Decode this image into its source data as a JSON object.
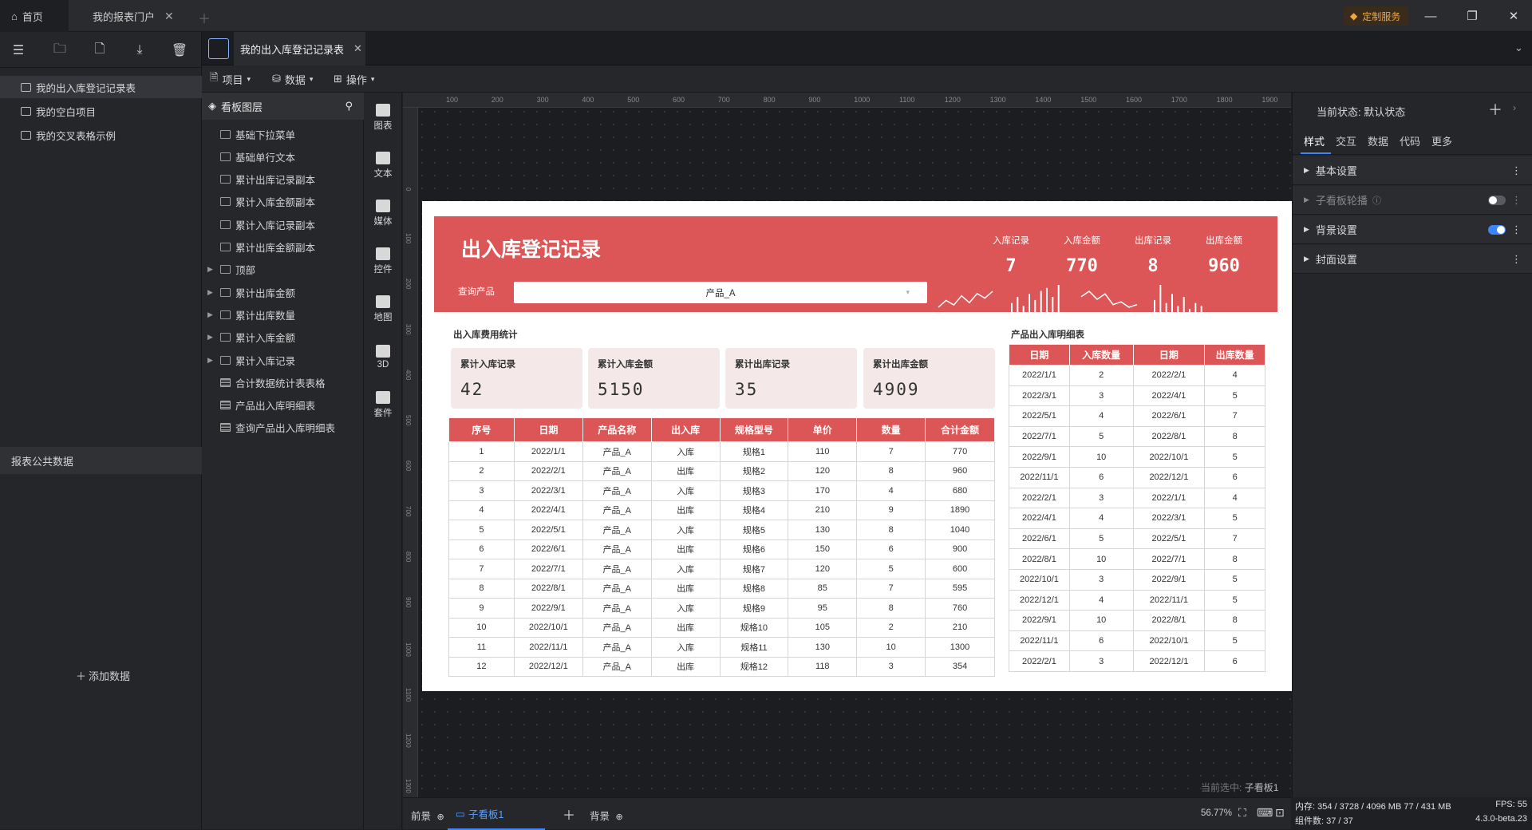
{
  "titlebar": {
    "tabs": [
      {
        "label": "首页",
        "icon": "home-icon"
      },
      {
        "label": "我的报表门户"
      }
    ],
    "custom_service": "定制服务"
  },
  "left_panel": {
    "projects": [
      {
        "label": "我的出入库登记记录表"
      },
      {
        "label": "我的空白项目"
      },
      {
        "label": "我的交叉表格示例"
      }
    ],
    "public_data_title": "报表公共数据",
    "add_data_label": "添加数据"
  },
  "doc_tab": {
    "label": "我的出入库登记记录表"
  },
  "toolbar": {
    "project": "项目",
    "data": "数据",
    "operate": "操作"
  },
  "layers": {
    "title": "看板图层",
    "items": [
      {
        "label": "基础下拉菜单",
        "group": false
      },
      {
        "label": "基础单行文本",
        "group": false
      },
      {
        "label": "累计出库记录副本",
        "group": false
      },
      {
        "label": "累计入库金额副本",
        "group": false
      },
      {
        "label": "累计入库记录副本",
        "group": false
      },
      {
        "label": "累计出库金额副本",
        "group": false
      },
      {
        "label": "顶部",
        "group": true
      },
      {
        "label": "累计出库金额",
        "group": true
      },
      {
        "label": "累计出库数量",
        "group": true
      },
      {
        "label": "累计入库金额",
        "group": true
      },
      {
        "label": "累计入库记录",
        "group": true
      },
      {
        "label": "合计数据统计表表格",
        "group": false
      },
      {
        "label": "产品出入库明细表",
        "group": false
      },
      {
        "label": "查询产品出入库明细表",
        "group": false
      }
    ]
  },
  "strip": [
    {
      "label": "图表",
      "icon": "chart-icon"
    },
    {
      "label": "文本",
      "icon": "text-icon"
    },
    {
      "label": "媒体",
      "icon": "media-icon"
    },
    {
      "label": "控件",
      "icon": "control-icon"
    },
    {
      "label": "地图",
      "icon": "map-icon"
    },
    {
      "label": "3D",
      "icon": "cube-icon"
    },
    {
      "label": "套件",
      "icon": "kit-icon"
    }
  ],
  "ruler": {
    "top": [
      "100",
      "200",
      "300",
      "400",
      "500",
      "600",
      "700",
      "800",
      "900",
      "1000",
      "1100",
      "1200",
      "1300",
      "1400",
      "1500",
      "1600",
      "1700",
      "1800",
      "1900"
    ],
    "left": [
      "0",
      "100",
      "200",
      "300",
      "400",
      "500",
      "600",
      "700",
      "800",
      "900",
      "1000",
      "1100",
      "1200",
      "1300"
    ]
  },
  "dashboard": {
    "title": "出入库登记记录",
    "query_label": "查询产品",
    "query_value": "产品_A",
    "kpis": [
      {
        "label": "入库记录",
        "value": "7"
      },
      {
        "label": "入库金额",
        "value": "770"
      },
      {
        "label": "出库记录",
        "value": "8"
      },
      {
        "label": "出库金额",
        "value": "960"
      }
    ],
    "sparklines": {
      "in_records": [
        3,
        6,
        4,
        8,
        5,
        9,
        7,
        10
      ],
      "in_amount": [
        3,
        5,
        2,
        6,
        4,
        7,
        8,
        5,
        9
      ],
      "out_records": [
        6,
        8,
        5,
        7,
        3,
        4,
        2,
        3
      ],
      "out_amount": [
        4,
        9,
        3,
        6,
        2,
        5,
        1,
        3,
        2
      ]
    },
    "stats_title": "出入库费用统计",
    "cards": [
      {
        "label": "累计入库记录",
        "value": "42"
      },
      {
        "label": "累计入库金额",
        "value": "5150"
      },
      {
        "label": "累计出库记录",
        "value": "35"
      },
      {
        "label": "累计出库金额",
        "value": "4909"
      }
    ],
    "main_table": {
      "headers": [
        "序号",
        "日期",
        "产品名称",
        "出入库",
        "规格型号",
        "单价",
        "数量",
        "合计金额"
      ],
      "rows": [
        [
          "1",
          "2022/1/1",
          "产品_A",
          "入库",
          "规格1",
          "110",
          "7",
          "770"
        ],
        [
          "2",
          "2022/2/1",
          "产品_A",
          "出库",
          "规格2",
          "120",
          "8",
          "960"
        ],
        [
          "3",
          "2022/3/1",
          "产品_A",
          "入库",
          "规格3",
          "170",
          "4",
          "680"
        ],
        [
          "4",
          "2022/4/1",
          "产品_A",
          "出库",
          "规格4",
          "210",
          "9",
          "1890"
        ],
        [
          "5",
          "2022/5/1",
          "产品_A",
          "入库",
          "规格5",
          "130",
          "8",
          "1040"
        ],
        [
          "6",
          "2022/6/1",
          "产品_A",
          "出库",
          "规格6",
          "150",
          "6",
          "900"
        ],
        [
          "7",
          "2022/7/1",
          "产品_A",
          "入库",
          "规格7",
          "120",
          "5",
          "600"
        ],
        [
          "8",
          "2022/8/1",
          "产品_A",
          "出库",
          "规格8",
          "85",
          "7",
          "595"
        ],
        [
          "9",
          "2022/9/1",
          "产品_A",
          "入库",
          "规格9",
          "95",
          "8",
          "760"
        ],
        [
          "10",
          "2022/10/1",
          "产品_A",
          "出库",
          "规格10",
          "105",
          "2",
          "210"
        ],
        [
          "11",
          "2022/11/1",
          "产品_A",
          "入库",
          "规格11",
          "130",
          "10",
          "1300"
        ],
        [
          "12",
          "2022/12/1",
          "产品_A",
          "出库",
          "规格12",
          "118",
          "3",
          "354"
        ]
      ]
    },
    "detail_title": "产品出入库明细表",
    "detail_table": {
      "headers": [
        "日期",
        "入库数量",
        "日期",
        "出库数量"
      ],
      "rows": [
        [
          "2022/1/1",
          "2",
          "2022/2/1",
          "4"
        ],
        [
          "2022/3/1",
          "3",
          "2022/4/1",
          "5"
        ],
        [
          "2022/5/1",
          "4",
          "2022/6/1",
          "7"
        ],
        [
          "2022/7/1",
          "5",
          "2022/8/1",
          "8"
        ],
        [
          "2022/9/1",
          "10",
          "2022/10/1",
          "5"
        ],
        [
          "2022/11/1",
          "6",
          "2022/12/1",
          "6"
        ],
        [
          "2022/2/1",
          "3",
          "2022/1/1",
          "4"
        ],
        [
          "2022/4/1",
          "4",
          "2022/3/1",
          "5"
        ],
        [
          "2022/6/1",
          "5",
          "2022/5/1",
          "7"
        ],
        [
          "2022/8/1",
          "10",
          "2022/7/1",
          "8"
        ],
        [
          "2022/10/1",
          "3",
          "2022/9/1",
          "5"
        ],
        [
          "2022/12/1",
          "4",
          "2022/11/1",
          "5"
        ],
        [
          "2022/9/1",
          "10",
          "2022/8/1",
          "8"
        ],
        [
          "2022/11/1",
          "6",
          "2022/10/1",
          "5"
        ],
        [
          "2022/2/1",
          "3",
          "2022/12/1",
          "6"
        ]
      ]
    }
  },
  "canvas_status": {
    "prefix": "当前选中:",
    "value": "子看板1"
  },
  "right_panel": {
    "state_label": "当前状态:",
    "state_value": "默认状态",
    "tabs": [
      "样式",
      "交互",
      "数据",
      "代码",
      "更多"
    ],
    "rows": [
      {
        "label": "基本设置"
      },
      {
        "label": "子看板轮播"
      },
      {
        "label": "背景设置"
      },
      {
        "label": "封面设置"
      }
    ]
  },
  "bottom_bar": {
    "foreground": "前景",
    "sub_board": "子看板1",
    "background": "背景",
    "zoom": "56.77%"
  },
  "status": {
    "memory": "内存: 354 / 3728 / 4096 MB  77 / 431 MB",
    "fps": "FPS: 55",
    "components": "组件数: 37 / 37",
    "version": "4.3.0-beta.23"
  },
  "colors": {
    "accent": "#dc5657",
    "card_bg": "#f4e8e8",
    "toggle_on": "#3a86ff",
    "brand_orange": "#f1a640"
  }
}
